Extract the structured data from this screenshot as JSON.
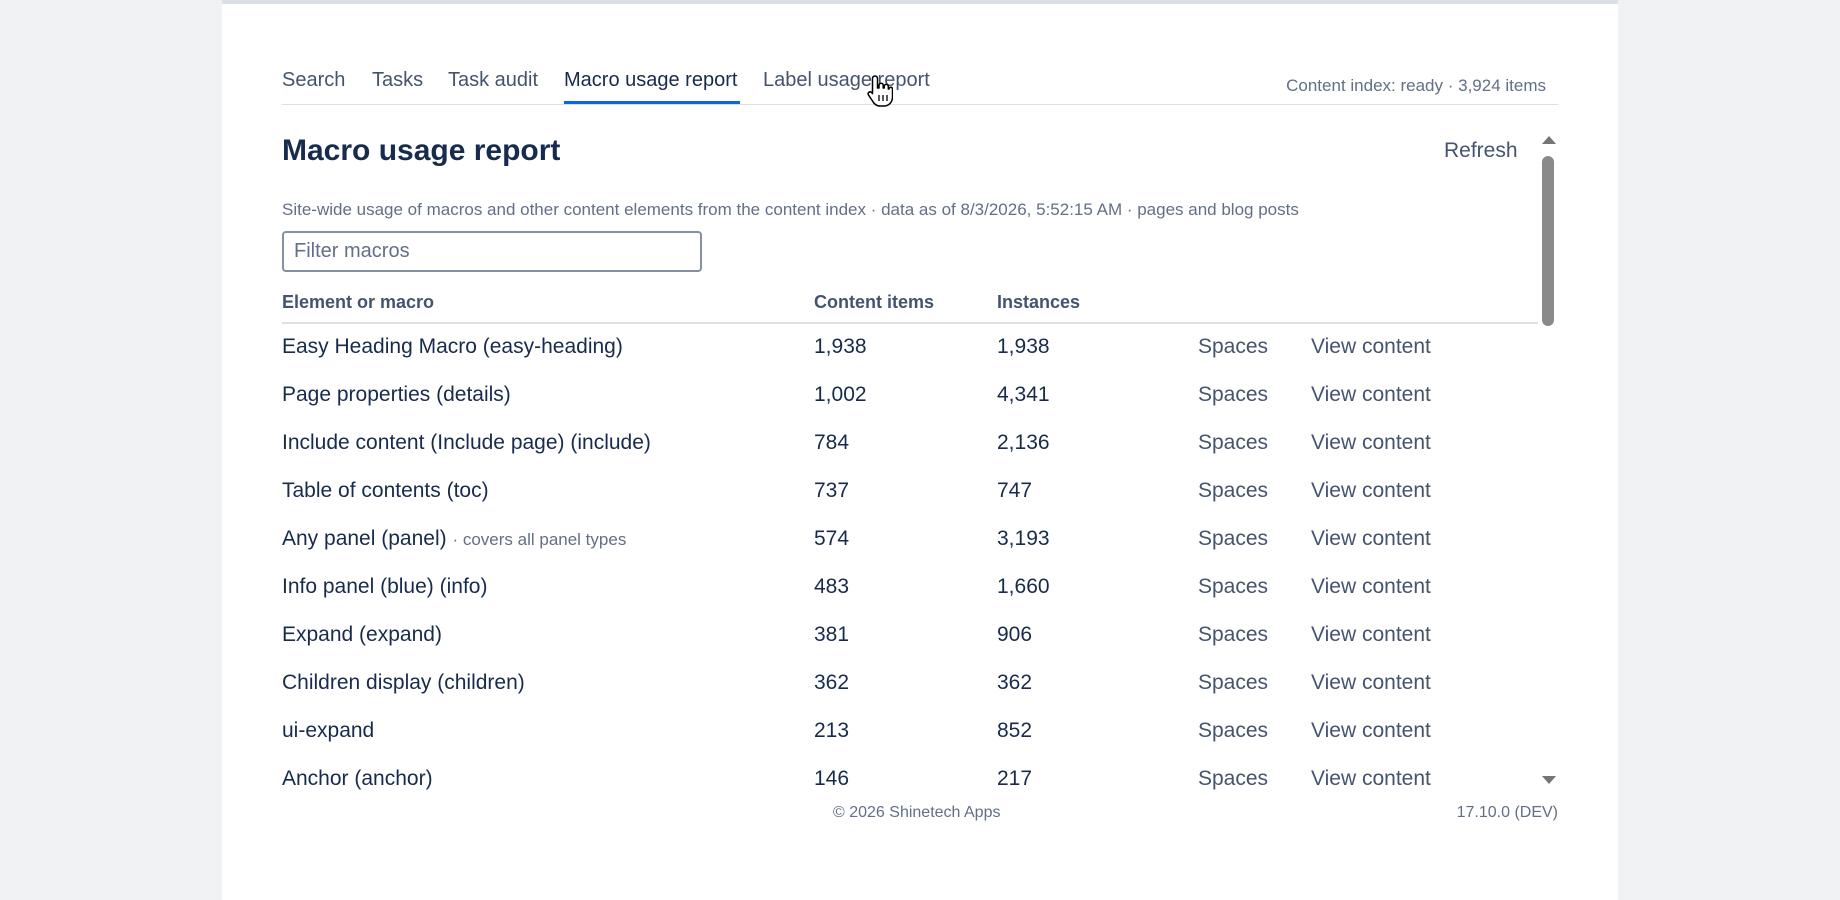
{
  "tabs": [
    {
      "label": "Search"
    },
    {
      "label": "Tasks"
    },
    {
      "label": "Task audit"
    },
    {
      "label": "Macro usage report"
    },
    {
      "label": "Label usage report"
    }
  ],
  "active_tab": "Macro usage report",
  "index_status": "Content index: ready · 3,924 items",
  "page": {
    "title": "Macro usage report",
    "refresh_label": "Refresh",
    "subtitle": "Site-wide usage of macros and other content elements from the content index · data as of 8/3/2026, 5:52:15 AM · pages and blog posts"
  },
  "filter": {
    "placeholder": "Filter macros",
    "value": ""
  },
  "table": {
    "headers": {
      "name": "Element or macro",
      "items": "Content items",
      "instances": "Instances"
    },
    "rows": [
      {
        "name": "Easy Heading Macro (easy-heading)",
        "note": "",
        "items": "1,938",
        "instances": "1,938",
        "spaces": "Spaces",
        "view": "View content"
      },
      {
        "name": "Page properties (details)",
        "note": "",
        "items": "1,002",
        "instances": "4,341",
        "spaces": "Spaces",
        "view": "View content"
      },
      {
        "name": "Include content (Include page) (include)",
        "note": "",
        "items": "784",
        "instances": "2,136",
        "spaces": "Spaces",
        "view": "View content"
      },
      {
        "name": "Table of contents (toc)",
        "note": "",
        "items": "737",
        "instances": "747",
        "spaces": "Spaces",
        "view": "View content"
      },
      {
        "name": "Any panel (panel)",
        "note": "· covers all panel types",
        "items": "574",
        "instances": "3,193",
        "spaces": "Spaces",
        "view": "View content"
      },
      {
        "name": "Info panel (blue) (info)",
        "note": "",
        "items": "483",
        "instances": "1,660",
        "spaces": "Spaces",
        "view": "View content"
      },
      {
        "name": "Expand (expand)",
        "note": "",
        "items": "381",
        "instances": "906",
        "spaces": "Spaces",
        "view": "View content"
      },
      {
        "name": "Children display (children)",
        "note": "",
        "items": "362",
        "instances": "362",
        "spaces": "Spaces",
        "view": "View content"
      },
      {
        "name": "ui-expand",
        "note": "",
        "items": "213",
        "instances": "852",
        "spaces": "Spaces",
        "view": "View content"
      },
      {
        "name": "Anchor (anchor)",
        "note": "",
        "items": "146",
        "instances": "217",
        "spaces": "Spaces",
        "view": "View content"
      }
    ]
  },
  "footer": {
    "copyright": "© 2026 Shinetech Apps",
    "version": "17.10.0 (DEV)"
  },
  "colors": {
    "accent": "#0c66e4",
    "text": "#172b4d",
    "muted": "#626f86",
    "background": "#f1f2f4"
  },
  "icons": {
    "cursor": "hand-pointer-icon"
  }
}
